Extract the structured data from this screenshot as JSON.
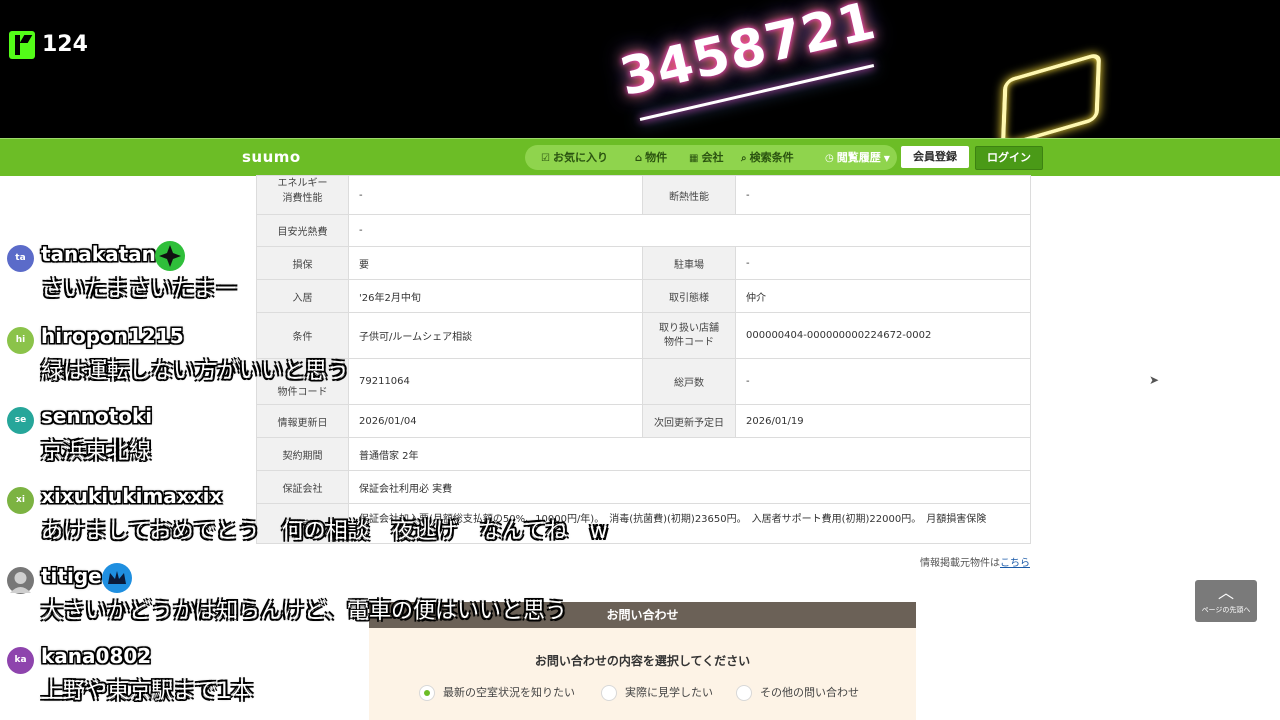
{
  "stream": {
    "viewer_count": "124",
    "overlay_number": "3458721"
  },
  "suumo": {
    "logo": "suumo",
    "nav": {
      "favorites": "お気に入り",
      "property": "物件",
      "company": "会社",
      "search_conditions": "検索条件",
      "history": "閲覧履歴",
      "register": "会員登録",
      "login": "ログイン"
    }
  },
  "detail_rows": [
    {
      "h1": "エネルギー\n消費性能",
      "v1": "-",
      "h2": "断熱性能",
      "v2": "-"
    },
    {
      "h1": "目安光熱費",
      "v1": "-"
    },
    {
      "h1": "損保",
      "v1": "要",
      "h2": "駐車場",
      "v2": "-"
    },
    {
      "h1": "入居",
      "v1": "'26年2月中旬",
      "h2": "取引態様",
      "v2": "仲介"
    },
    {
      "h1": "条件",
      "v1": "子供可/ルームシェア相談",
      "h2": "取り扱い店舗\n物件コード",
      "v2": "000000404-000000000224672-0002"
    },
    {
      "h1": "物件コード",
      "v1": "79211064",
      "h2": "総戸数",
      "v2": "-"
    },
    {
      "h1": "情報更新日",
      "v1": "2026/01/04",
      "h2": "次回更新予定日",
      "v2": "2026/01/19"
    },
    {
      "h1": "契約期間",
      "v1": "普通借家 2年"
    },
    {
      "h1": "保証会社",
      "v1": "保証会社利用必 実費"
    },
    {
      "h1": "備考",
      "v1": "保証会社加入要(月額総支払額の50%、10000円/年)。　消毒(抗菌費)(初期)23650円。　入居者サポート費用(初期)22000円。　月額損害保険"
    }
  ],
  "source_note": {
    "text": "情報掲載元物件は",
    "link": "こちら"
  },
  "inquiry": {
    "header": "お問い合わせ",
    "question": "お問い合わせの内容を選択してください",
    "options": [
      "最新の空室状況を知りたい",
      "実際に見学したい",
      "その他の問い合わせ"
    ],
    "selected_index": 0
  },
  "back_to_top": "ページの先頭へ",
  "chat": [
    {
      "avatar": "ta",
      "avatar_color": "#5b6bc9",
      "user": "tanakatan",
      "text": "さいたまさいたまー"
    },
    {
      "avatar": "hi",
      "avatar_color": "#8bc34a",
      "user": "hiropon1215",
      "text": "緑は運転しない方がいいと思う"
    },
    {
      "avatar": "se",
      "avatar_color": "#26a69a",
      "user": "sennotoki",
      "text": "京浜東北線"
    },
    {
      "avatar": "xi",
      "avatar_color": "#7cb342",
      "user": "xixukiukimaxxix",
      "text": "あけましておめでとう　何の相談　夜逃げ　なんてね　w"
    },
    {
      "avatar": "",
      "avatar_color": "#777777",
      "user": "titige",
      "text": "大きいかどうかは知らんけど、電車の便はいいと思う"
    },
    {
      "avatar": "ka",
      "avatar_color": "#8e44ad",
      "user": "kana0802",
      "text": "上野や東京駅まで1本"
    }
  ]
}
